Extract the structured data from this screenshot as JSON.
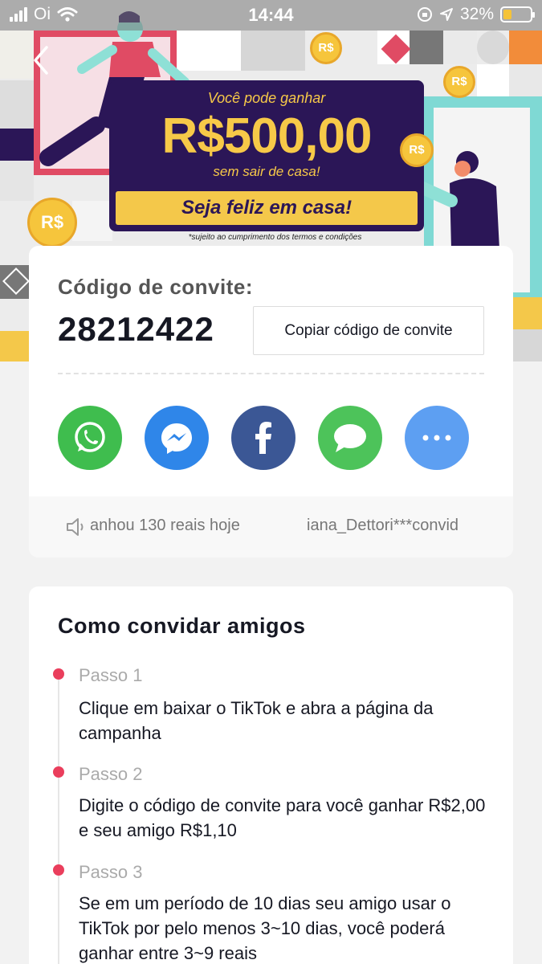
{
  "status_bar": {
    "carrier": "Oi",
    "time": "14:44",
    "battery_text": "32%",
    "battery_level": 0.32
  },
  "banner": {
    "line1": "Você pode ganhar",
    "amount": "R$500,00",
    "line3": "sem sair de casa!",
    "cta": "Seja feliz em casa!",
    "terms": "*sujeito ao cumprimento dos termos e condições",
    "coin_label": "R$"
  },
  "invite": {
    "label": "Código de convite:",
    "code": "28212422",
    "copy_button": "Copiar código de convite"
  },
  "share": [
    "whatsapp-icon",
    "messenger-icon",
    "facebook-icon",
    "message-icon",
    "more-icon"
  ],
  "ticker": {
    "item1": "anhou 130 reais hoje",
    "item2": "iana_Dettori***convid"
  },
  "how_to": {
    "title": "Como convidar amigos",
    "steps": [
      {
        "label": "Passo 1",
        "text": "Clique em baixar o TikTok e abra a página da campanha"
      },
      {
        "label": "Passo 2",
        "text": "Digite o código de convite para você ganhar R$2,00 e seu amigo R$1,10"
      },
      {
        "label": "Passo 3",
        "text": "Se em um período de 10 dias seu amigo usar o TikTok por pelo menos 3~10 dias, você poderá ganhar entre 3~9 reais"
      }
    ]
  },
  "colors": {
    "accent_red": "#ea3e5c",
    "promo_purple": "#2b1657",
    "promo_yellow": "#f4c84a",
    "whatsapp": "#3fbd4e",
    "messenger": "#2f86e9",
    "facebook": "#3b5795",
    "message": "#4dc35a",
    "more": "#5d9ff2"
  }
}
